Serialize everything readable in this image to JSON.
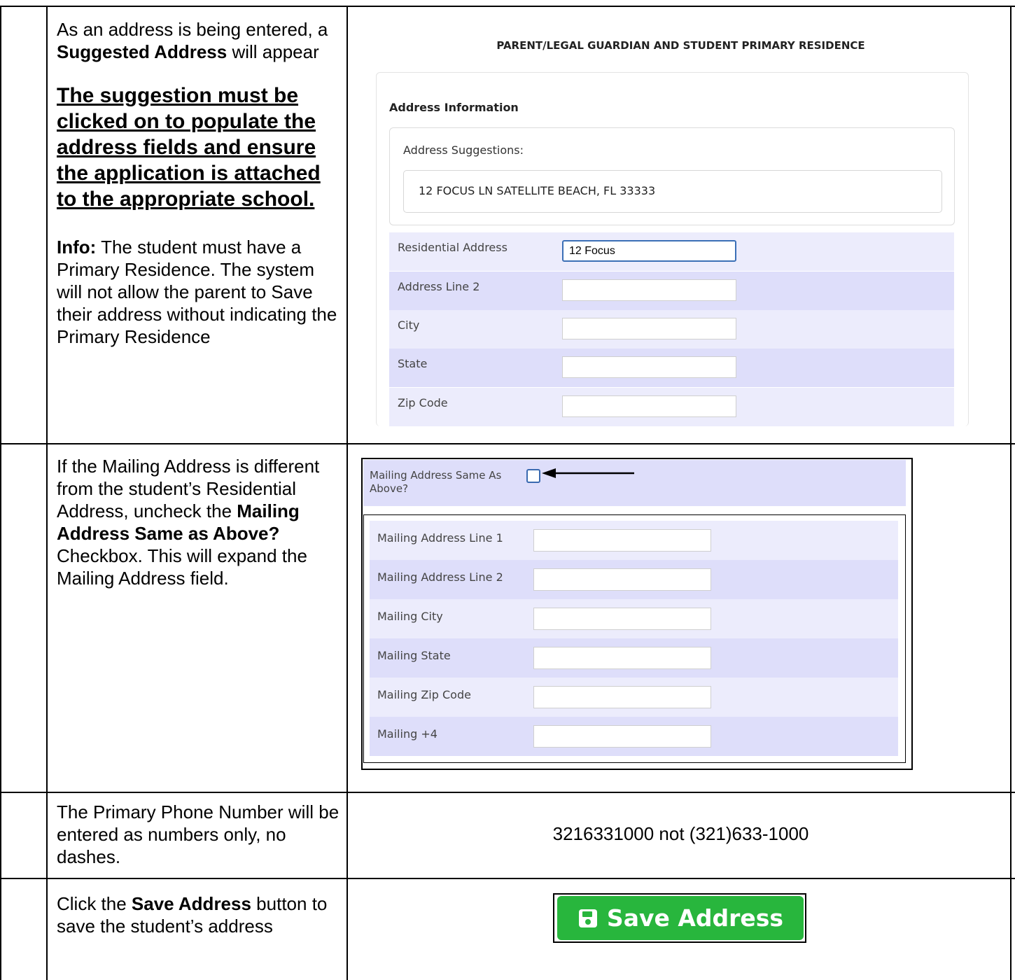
{
  "rows": [
    {
      "instruction_intro_1": "As an address is being entered, a ",
      "instruction_bold_1": "Suggested Address",
      "instruction_intro_2": " will appear",
      "instruction_emphasis": "The suggestion must be clicked on to populate the address fields and ensure the application is attached to the appropriate school.",
      "info_label": "Info:",
      "info_text": " The student must have a Primary Residence. The system will not allow the parent to Save their address without indicating the Primary Residence"
    },
    {
      "instruction_1": "If the Mailing Address is different from the student’s Residential Address, uncheck the ",
      "instruction_bold": "Mailing Address Same as Above?",
      "instruction_2": " Checkbox. This will expand the Mailing Address field."
    },
    {
      "instruction": "The Primary Phone Number will be entered as numbers only, no dashes."
    },
    {
      "instruction_1": "Click the ",
      "instruction_bold": "Save Address",
      "instruction_2": " button to save the student’s address"
    }
  ],
  "residence_form": {
    "section_heading": "PARENT/LEGAL GUARDIAN AND STUDENT PRIMARY RESIDENCE",
    "card_title": "Address Information",
    "suggestions_label": "Address Suggestions:",
    "suggestion": "12 FOCUS LN SATELLITE BEACH, FL 33333",
    "fields": [
      {
        "label": "Residential Address",
        "value": "12 Focus"
      },
      {
        "label": "Address Line 2",
        "value": ""
      },
      {
        "label": "City",
        "value": ""
      },
      {
        "label": "State",
        "value": ""
      },
      {
        "label": "Zip Code",
        "value": ""
      }
    ]
  },
  "mailing_form": {
    "same_as_above_label": "Mailing Address Same As Above?",
    "same_as_above_checked": false,
    "fields": [
      {
        "label": "Mailing Address Line 1",
        "value": ""
      },
      {
        "label": "Mailing Address Line 2",
        "value": ""
      },
      {
        "label": "Mailing City",
        "value": ""
      },
      {
        "label": "Mailing State",
        "value": ""
      },
      {
        "label": "Mailing Zip Code",
        "value": ""
      },
      {
        "label": "Mailing +4",
        "value": ""
      }
    ]
  },
  "phone_example": "3216331000 not (321)633-1000",
  "save_button": {
    "label": "Save Address",
    "icon": "floppy-disk-icon",
    "color": "#28b63d"
  },
  "colors": {
    "row_light": "#ececfc",
    "row_dark": "#dedefa",
    "focus_border": "#3b6fb6"
  }
}
